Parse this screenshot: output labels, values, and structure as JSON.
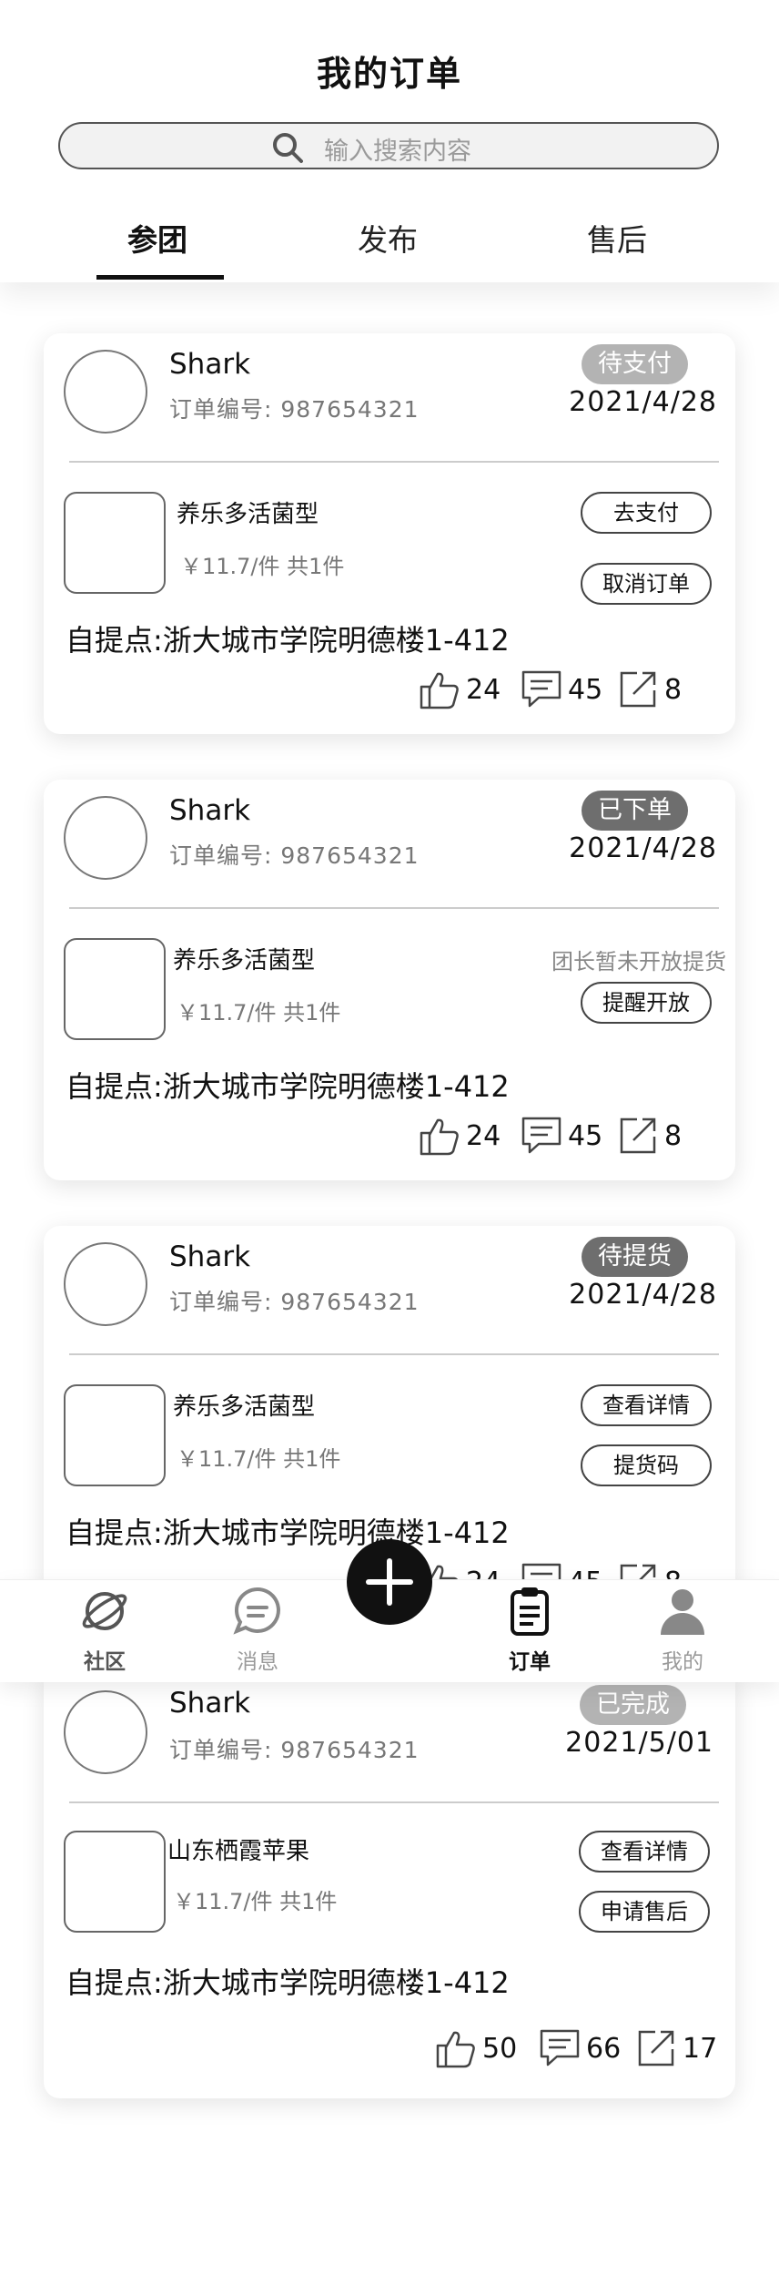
{
  "header": {
    "title": "我的订单",
    "search_placeholder": "输入搜索内容",
    "tabs": [
      "参团",
      "发布",
      "售后"
    ]
  },
  "orders": [
    {
      "user": "Shark",
      "order_no": "订单编号: 987654321",
      "status": "待支付",
      "status_color": "#b3b3b3",
      "date": "2021/4/28",
      "product": "养乐多活菌型",
      "price": "￥11.7/件 共1件",
      "buttons": [
        "去支付",
        "取消订单"
      ],
      "note": "",
      "address": "自提点:浙大城市学院明德楼1-412",
      "likes": "24",
      "comments": "45",
      "shares": "8"
    },
    {
      "user": "Shark",
      "order_no": "订单编号: 987654321",
      "status": "已下单",
      "status_color": "#6e6e6e",
      "date": "2021/4/28",
      "product": "养乐多活菌型",
      "price": "￥11.7/件 共1件",
      "buttons": [
        "提醒开放"
      ],
      "note": "团长暂未开放提货",
      "address": "自提点:浙大城市学院明德楼1-412",
      "likes": "24",
      "comments": "45",
      "shares": "8"
    },
    {
      "user": "Shark",
      "order_no": "订单编号: 987654321",
      "status": "待提货",
      "status_color": "#6e6e6e",
      "date": "2021/4/28",
      "product": "养乐多活菌型",
      "price": "￥11.7/件 共1件",
      "buttons": [
        "查看详情",
        "提货码"
      ],
      "note": "",
      "address": "自提点:浙大城市学院明德楼1-412",
      "likes": "24",
      "comments": "45",
      "shares": "8"
    },
    {
      "user": "Shark",
      "order_no": "订单编号: 987654321",
      "status": "已完成",
      "status_color": "#b3b3b3",
      "date": "2021/5/01",
      "product": "山东栖霞苹果",
      "price": "￥11.7/件 共1件",
      "buttons": [
        "查看详情",
        "申请售后"
      ],
      "note": "",
      "address": "自提点:浙大城市学院明德楼1-412",
      "likes": "50",
      "comments": "66",
      "shares": "17"
    }
  ],
  "tabbar": {
    "items": [
      {
        "label": "社区",
        "icon": "planet-icon",
        "color": "#555555"
      },
      {
        "label": "消息",
        "icon": "chat-bubble-icon",
        "color": "#9a9a9a"
      },
      {
        "label": "订单",
        "icon": "clipboard-icon",
        "color": "#111111"
      },
      {
        "label": "我的",
        "icon": "user-icon",
        "color": "#9a9a9a"
      }
    ],
    "fab_icon": "plus-icon"
  }
}
